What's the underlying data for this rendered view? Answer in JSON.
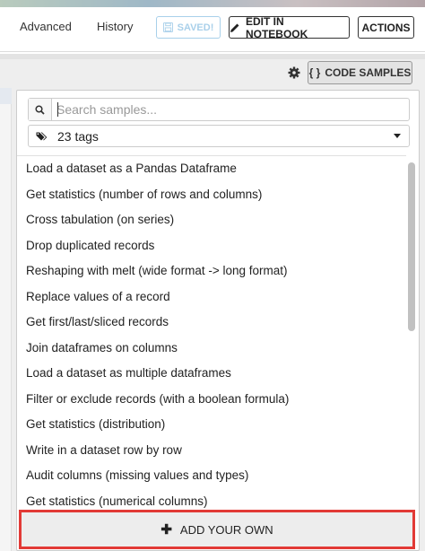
{
  "header": {
    "tabs": [
      {
        "label": "Advanced"
      },
      {
        "label": "History"
      }
    ],
    "saved_label": "SAVED!",
    "edit_notebook_label": "EDIT IN NOTEBOOK",
    "actions_label": "ACTIONS"
  },
  "toolbar": {
    "settings_icon": "gear-icon",
    "code_samples_icon_text": "{ }",
    "code_samples_label": "CODE SAMPLES"
  },
  "samples": {
    "search": {
      "placeholder": "Search samples...",
      "value": ""
    },
    "tags": {
      "selected": "23 tags"
    },
    "items": [
      "Load a dataset as a Pandas Dataframe",
      "Get statistics (number of rows and columns)",
      "Cross tabulation (on series)",
      "Drop duplicated records",
      "Reshaping with melt (wide format -> long format)",
      "Replace values of a record",
      "Get first/last/sliced records",
      "Join dataframes on columns",
      "Load a dataset as multiple dataframes",
      "Filter or exclude records (with a boolean formula)",
      "Get statistics (distribution)",
      "Write in a dataset row by row",
      "Audit columns (missing values and types)",
      "Get statistics (numerical columns)"
    ],
    "add_label": "ADD YOUR OWN"
  },
  "colors": {
    "highlight_border": "#e23a36",
    "saved_blue": "#a9d0ea"
  }
}
